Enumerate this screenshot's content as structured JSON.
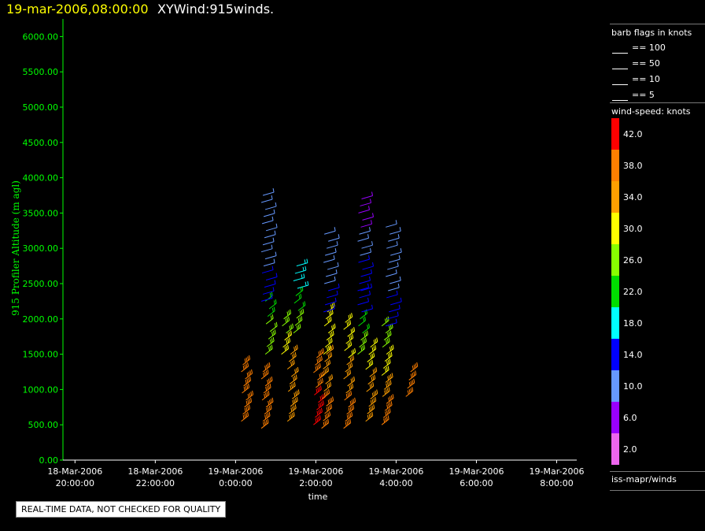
{
  "header": {
    "datetime": "19-mar-2006,08:00:00",
    "plot_name": "XYWind:915winds."
  },
  "notice": "REAL-TIME DATA, NOT CHECKED FOR QUALITY",
  "legend": {
    "flags_title": "barb flags in knots",
    "flags": [
      "== 100",
      "== 50",
      "== 10",
      "== 5"
    ],
    "speed_title": "wind-speed: knots",
    "speed_labels": [
      "42.0",
      "38.0",
      "34.0",
      "30.0",
      "26.0",
      "22.0",
      "18.0",
      "14.0",
      "10.0",
      "6.0",
      "2.0"
    ],
    "speed_colors": [
      "#ff0000",
      "#ff7f00",
      "#ff9f00",
      "#ffff00",
      "#88ff00",
      "#00dd00",
      "#00ffff",
      "#0000ff",
      "#6699ff",
      "#9900ff",
      "#ee66ee"
    ],
    "source": "iss-mapr/winds"
  },
  "chart_data": {
    "type": "scatter",
    "subtype": "wind-barb time-height",
    "ylabel": "915 Profiler Altitude (m agl)",
    "xlabel": "time",
    "ylim": [
      0,
      6250
    ],
    "yticks": [
      0,
      500,
      1000,
      1500,
      2000,
      2500,
      3000,
      3500,
      4000,
      4500,
      5000,
      5500,
      6000
    ],
    "ytick_labels": [
      "0.00",
      "500.00",
      "1000.00",
      "1500.00",
      "2000.00",
      "2500.00",
      "3000.00",
      "3500.00",
      "4000.00",
      "4500.00",
      "5000.00",
      "5500.00",
      "6000.00"
    ],
    "xlim_hours": [
      19.7,
      32.5
    ],
    "xticks_hours": [
      20,
      22,
      24,
      26,
      28,
      30,
      32
    ],
    "xtick_labels": [
      [
        "18-Mar-2006",
        "20:00:00"
      ],
      [
        "18-Mar-2006",
        "22:00:00"
      ],
      [
        "19-Mar-2006",
        "0:00:00"
      ],
      [
        "19-Mar-2006",
        "2:00:00"
      ],
      [
        "19-Mar-2006",
        "4:00:00"
      ],
      [
        "19-Mar-2006",
        "6:00:00"
      ],
      [
        "19-Mar-2006",
        "8:00:00"
      ]
    ],
    "profiles": [
      {
        "t": 24.2,
        "z0": 550,
        "z1": 1350,
        "speed": [
          36
        ]
      },
      {
        "t": 24.7,
        "z0": 450,
        "z1": 1250,
        "speed": [
          37
        ]
      },
      {
        "t": 24.8,
        "z0": 1500,
        "z1": 2250,
        "speed": [
          27,
          24,
          20
        ]
      },
      {
        "t": 24.7,
        "z0": 2250,
        "z1": 3750,
        "speed": [
          12,
          11,
          10
        ]
      },
      {
        "t": 25.2,
        "z0": 1500,
        "z1": 2000,
        "speed": [
          28,
          26
        ]
      },
      {
        "t": 25.35,
        "z0": 550,
        "z1": 1500,
        "speed": [
          35,
          34
        ]
      },
      {
        "t": 25.5,
        "z0": 1800,
        "z1": 2750,
        "speed": [
          26,
          22,
          18
        ]
      },
      {
        "t": 26.0,
        "z0": 500,
        "z1": 1450,
        "speed": [
          42,
          39
        ]
      },
      {
        "t": 26.2,
        "z0": 450,
        "z1": 1500,
        "speed": [
          36,
          34
        ]
      },
      {
        "t": 26.25,
        "z0": 1500,
        "z1": 2100,
        "speed": [
          30,
          28
        ]
      },
      {
        "t": 26.25,
        "z0": 2100,
        "z1": 3200,
        "speed": [
          14,
          9,
          8
        ]
      },
      {
        "t": 26.75,
        "z0": 450,
        "z1": 1950,
        "speed": [
          36,
          34,
          31
        ]
      },
      {
        "t": 27.1,
        "z0": 1500,
        "z1": 2400,
        "speed": [
          26,
          20,
          14
        ]
      },
      {
        "t": 27.1,
        "z0": 2400,
        "z1": 3700,
        "speed": [
          12,
          8,
          7
        ]
      },
      {
        "t": 27.3,
        "z0": 550,
        "z1": 1600,
        "speed": [
          35,
          33,
          30
        ]
      },
      {
        "t": 27.7,
        "z0": 500,
        "z1": 1900,
        "speed": [
          38,
          35,
          30,
          26
        ]
      },
      {
        "t": 27.8,
        "z0": 1900,
        "z1": 3300,
        "speed": [
          13,
          10,
          8
        ]
      },
      {
        "t": 28.3,
        "z0": 900,
        "z1": 1250,
        "speed": [
          36
        ]
      }
    ]
  }
}
